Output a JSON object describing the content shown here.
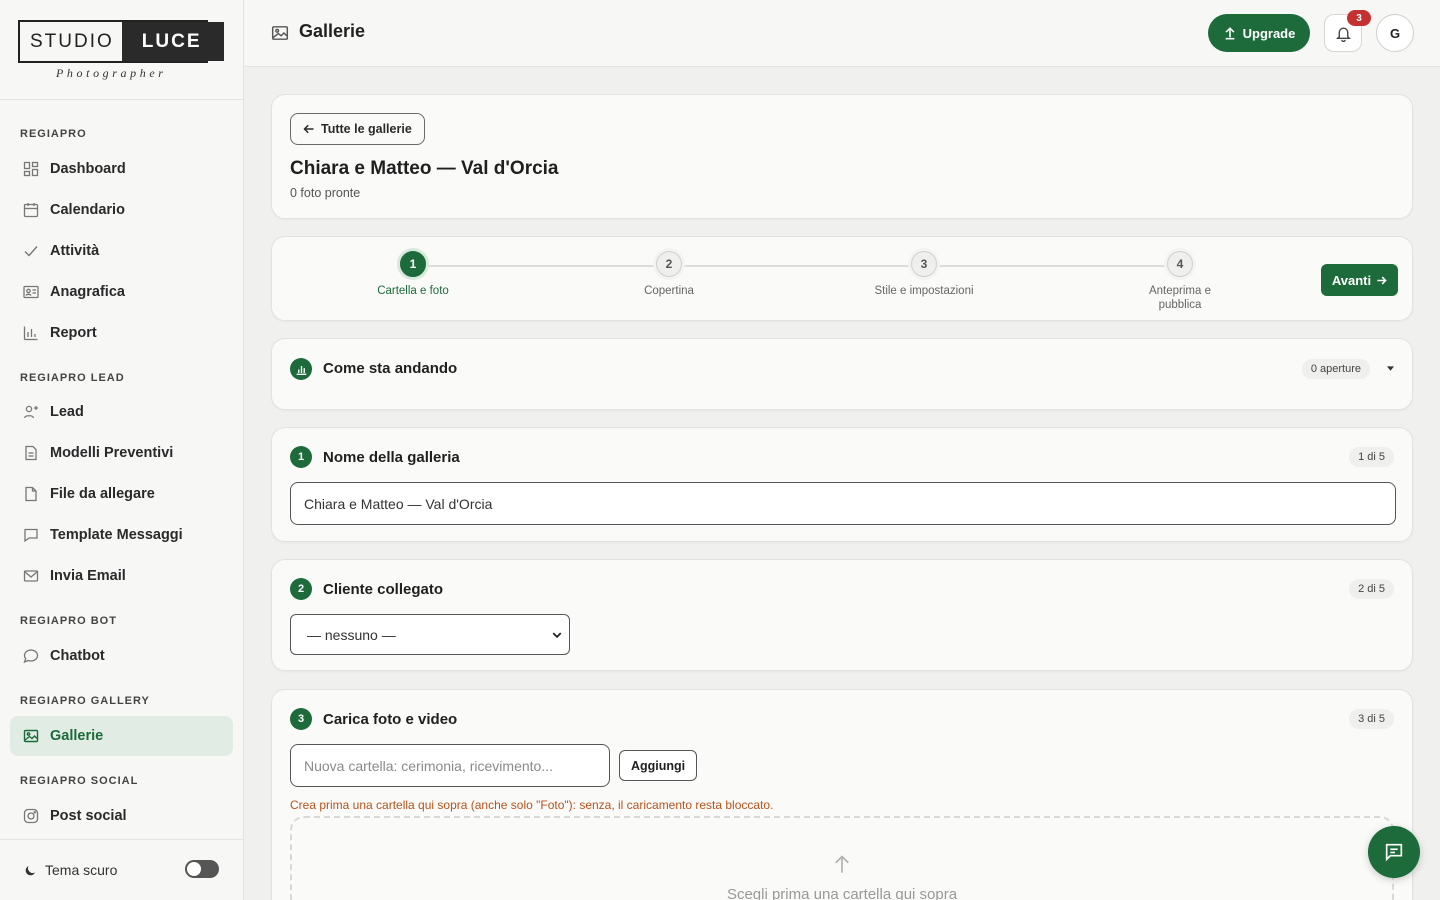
{
  "brand": {
    "studio": "STUDIO",
    "luce": "LUCE",
    "sub": "Photographer"
  },
  "sidebar": {
    "sections": [
      {
        "title": "REGIAPRO",
        "items": [
          {
            "label": "Dashboard",
            "icon": "grid-icon"
          },
          {
            "label": "Calendario",
            "icon": "calendar-icon"
          },
          {
            "label": "Attività",
            "icon": "check-icon"
          },
          {
            "label": "Anagrafica",
            "icon": "id-card-icon"
          },
          {
            "label": "Report",
            "icon": "bar-chart-icon"
          }
        ]
      },
      {
        "title": "REGIAPRO LEAD",
        "items": [
          {
            "label": "Lead",
            "icon": "user-plus-icon"
          },
          {
            "label": "Modelli Preventivi",
            "icon": "document-icon"
          },
          {
            "label": "File da allegare",
            "icon": "file-icon"
          },
          {
            "label": "Template Messaggi",
            "icon": "message-icon"
          },
          {
            "label": "Invia Email",
            "icon": "mail-icon"
          }
        ]
      },
      {
        "title": "REGIAPRO BOT",
        "items": [
          {
            "label": "Chatbot",
            "icon": "chat-bubble-icon"
          }
        ]
      },
      {
        "title": "REGIAPRO GALLERY",
        "items": [
          {
            "label": "Gallerie",
            "icon": "image-icon",
            "active": true
          }
        ]
      },
      {
        "title": "REGIAPRO SOCIAL",
        "items": [
          {
            "label": "Post social",
            "icon": "instagram-icon"
          }
        ]
      }
    ],
    "footer": {
      "theme_label": "Tema scuro",
      "dark_mode": false
    }
  },
  "header": {
    "title": "Gallerie",
    "upgrade_label": "Upgrade",
    "notifications_count": "3",
    "avatar_initial": "G"
  },
  "gallery": {
    "back_label": "Tutte le gallerie",
    "title": "Chiara e Matteo — Val d'Orcia",
    "subtitle": "0 foto pronte"
  },
  "stepper": {
    "steps": [
      {
        "num": "1",
        "label": "Cartella e foto",
        "active": true
      },
      {
        "num": "2",
        "label": "Copertina",
        "active": false
      },
      {
        "num": "3",
        "label": "Stile e impostazioni",
        "active": false
      },
      {
        "num": "4",
        "label": "Anteprima e pubblica",
        "active": false
      }
    ],
    "next_label": "Avanti"
  },
  "stats": {
    "title": "Come sta andando",
    "opens": "0 aperture"
  },
  "section_name": {
    "num": "1",
    "title": "Nome della galleria",
    "progress": "1 di 5",
    "value": "Chiara e Matteo — Val d'Orcia"
  },
  "section_client": {
    "num": "2",
    "title": "Cliente collegato",
    "progress": "2 di 5",
    "selected": "— nessuno —"
  },
  "section_upload": {
    "num": "3",
    "title": "Carica foto e video",
    "progress": "3 di 5",
    "folder_placeholder": "Nuova cartella: cerimonia, ricevimento...",
    "add_label": "Aggiungi",
    "warning": "Crea prima una cartella qui sopra (anche solo \"Foto\"): senza, il caricamento resta bloccato.",
    "dropzone_text": "Scegli prima una cartella qui sopra"
  },
  "colors": {
    "accent": "#1d6a3a",
    "accent_soft": "#e1ece4",
    "warning": "#b5541b",
    "badge": "#c53030"
  }
}
